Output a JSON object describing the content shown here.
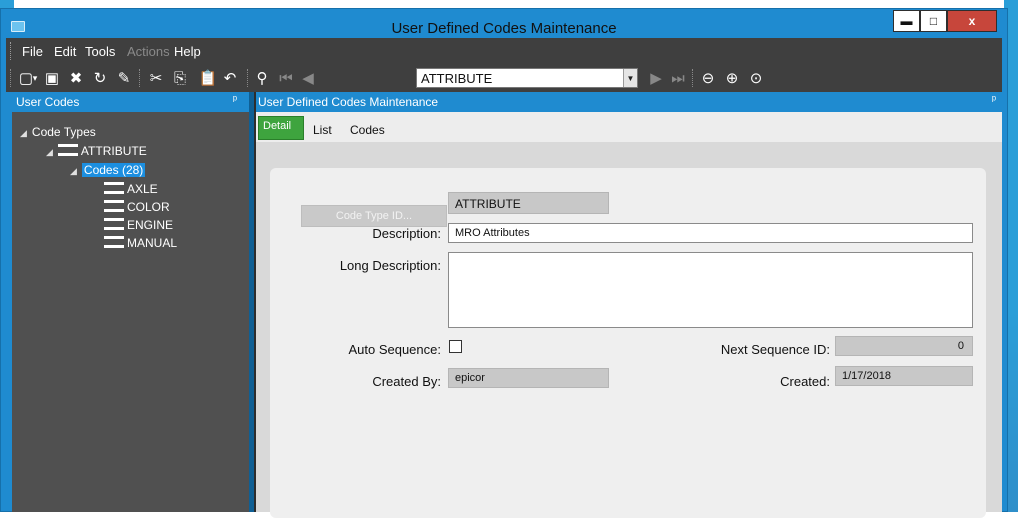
{
  "window": {
    "title": "User Defined Codes Maintenance",
    "buttons": {
      "minimize": "▬",
      "maximize": "□",
      "close": "x"
    }
  },
  "menu": {
    "items": [
      {
        "label": "File",
        "enabled": true
      },
      {
        "label": "Edit",
        "enabled": true
      },
      {
        "label": "Tools",
        "enabled": true
      },
      {
        "label": "Actions",
        "enabled": false
      },
      {
        "label": "Help",
        "enabled": true
      }
    ]
  },
  "toolbar": {
    "nav_value": "ATTRIBUTE",
    "icons": [
      "new-icon",
      "save-icon",
      "delete-icon",
      "refresh-icon",
      "clear-icon",
      "cut-icon",
      "copy-icon",
      "paste-icon",
      "undo-icon",
      "search-icon",
      "first-icon",
      "previous-icon",
      "next-icon",
      "last-icon",
      "back-icon",
      "forward-icon",
      "home-icon"
    ]
  },
  "left_pane": {
    "title": "User Codes",
    "pin": "ᵖ",
    "tree": {
      "root": "Code Types",
      "type": "ATTRIBUTE",
      "codes_node": "Codes (28)",
      "codes": [
        "AXLE",
        "COLOR",
        "ENGINE",
        "MANUAL"
      ]
    }
  },
  "right_pane": {
    "title": "User Defined Codes Maintenance",
    "pin": "ᵖ",
    "tabs": [
      "Detail",
      "List",
      "Codes"
    ],
    "active_tab": "Detail"
  },
  "form": {
    "code_type_button": "Code Type ID...",
    "code_type_id": "ATTRIBUTE",
    "description_label": "Description:",
    "description": "MRO Attributes",
    "long_description_label": "Long Description:",
    "long_description": "",
    "auto_sequence_label": "Auto Sequence:",
    "auto_sequence": false,
    "next_sequence_label": "Next Sequence ID:",
    "next_sequence": "0",
    "created_by_label": "Created By:",
    "created_by": "epicor",
    "created_label": "Created:",
    "created": "1/17/2018"
  },
  "colors": {
    "accent": "#1f8bd0",
    "active_tab": "#3ea43e",
    "pane_dark": "#505050",
    "toolbar": "#3f3f3f"
  }
}
